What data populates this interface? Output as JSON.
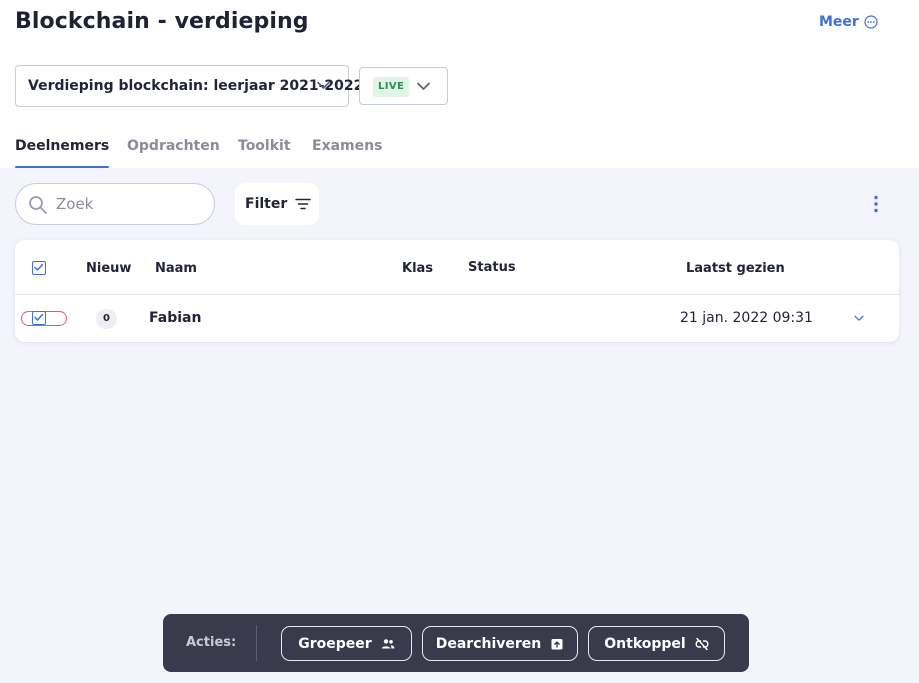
{
  "header": {
    "title": "Blockchain - verdieping",
    "more_label": "Meer"
  },
  "selectors": {
    "year": "Verdieping blockchain: leerjaar 2021-2022",
    "status": "LIVE"
  },
  "tabs": [
    {
      "label": "Deelnemers",
      "active": true
    },
    {
      "label": "Opdrachten",
      "active": false
    },
    {
      "label": "Toolkit",
      "active": false
    },
    {
      "label": "Examens",
      "active": false
    }
  ],
  "toolbar": {
    "search_placeholder": "Zoek",
    "filter_label": "Filter"
  },
  "table": {
    "columns": {
      "new": "Nieuw",
      "name": "Naam",
      "class": "Klas",
      "status": "Status",
      "last_seen": "Laatst gezien"
    },
    "rows": [
      {
        "selected": true,
        "new_count": "0",
        "name": "Fabian",
        "class": "",
        "status": "",
        "last_seen": "21 jan. 2022 09:31"
      }
    ]
  },
  "actions": {
    "label": "Acties:",
    "group": "Groepeer",
    "unarchive": "Dearchiveren",
    "unlink": "Ontkoppel"
  },
  "colors": {
    "accent": "#3f6fd8",
    "live_bg": "#e2f4e8",
    "live_text": "#2f8d51",
    "action_bar": "#393b4d",
    "row_highlight": "#e05d5d"
  }
}
